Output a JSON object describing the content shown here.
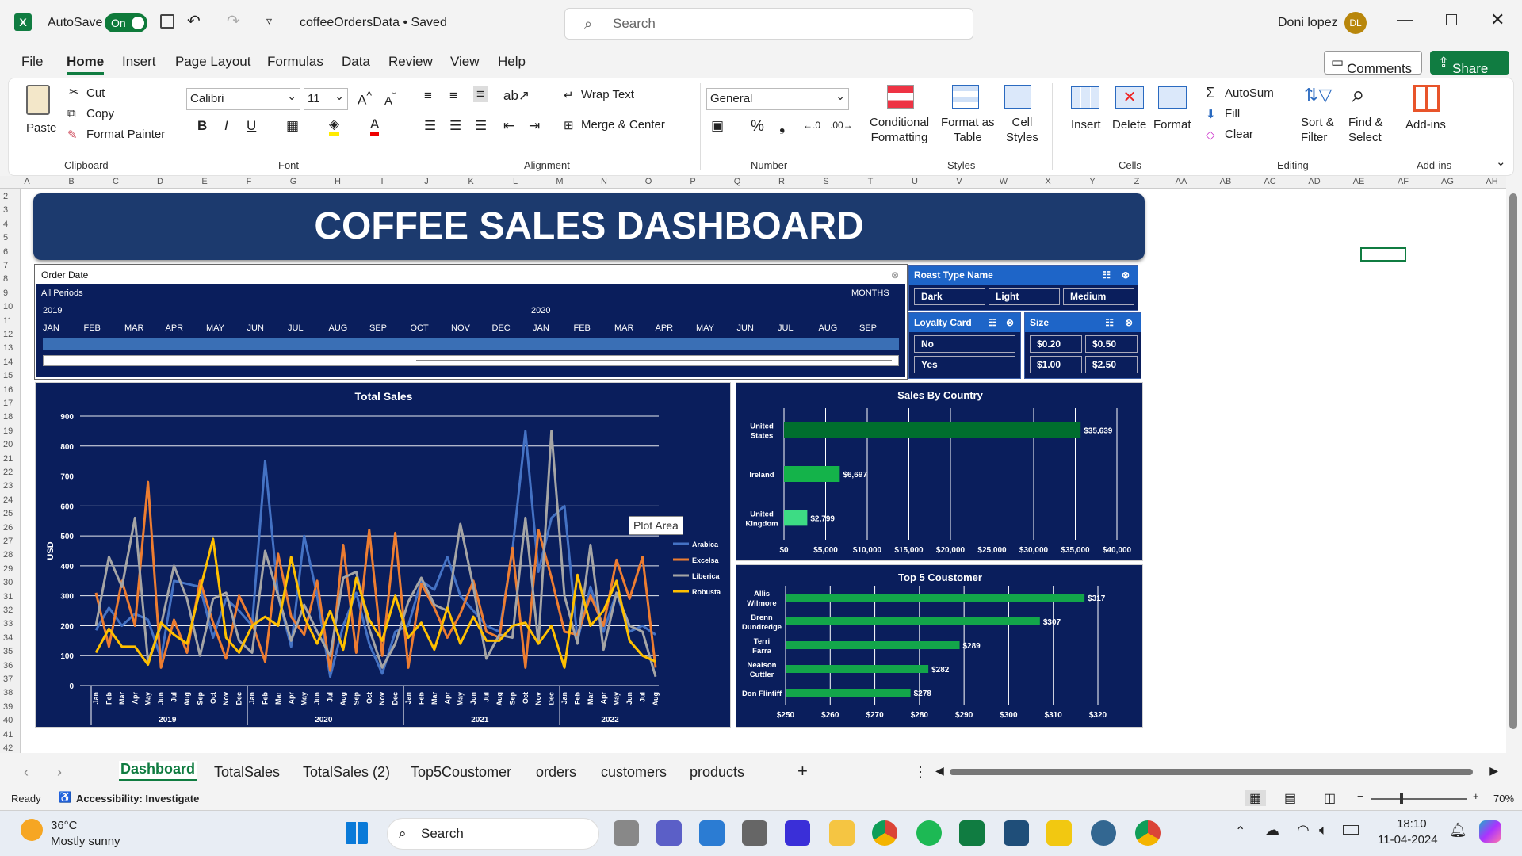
{
  "app": {
    "autosave_label": "AutoSave",
    "autosave_state": "On",
    "filename": "coffeeOrdersData • Saved",
    "search_placeholder": "Search",
    "user_name": "Doni lopez",
    "user_initials": "DL"
  },
  "menu": [
    "File",
    "Home",
    "Insert",
    "Page Layout",
    "Formulas",
    "Data",
    "Review",
    "View",
    "Help"
  ],
  "menu_right": {
    "comments": "Comments",
    "share": "Share"
  },
  "ribbon": {
    "clipboard": {
      "paste": "Paste",
      "cut": "Cut",
      "copy": "Copy",
      "format_painter": "Format Painter",
      "group": "Clipboard"
    },
    "font": {
      "name": "Calibri",
      "size": "11",
      "group": "Font"
    },
    "alignment": {
      "wrap": "Wrap Text",
      "merge": "Merge & Center",
      "group": "Alignment"
    },
    "number": {
      "format": "General",
      "group": "Number"
    },
    "styles": {
      "cond1": "Conditional",
      "cond2": "Formatting",
      "fat1": "Format as",
      "fat2": "Table",
      "cs1": "Cell",
      "cs2": "Styles",
      "group": "Styles"
    },
    "cells": {
      "insert": "Insert",
      "delete": "Delete",
      "format": "Format",
      "group": "Cells"
    },
    "editing": {
      "autosum": "AutoSum",
      "fill": "Fill",
      "clear": "Clear",
      "sort1": "Sort &",
      "sort2": "Filter",
      "find1": "Find &",
      "find2": "Select",
      "group": "Editing"
    },
    "addins": {
      "label": "Add-ins",
      "group": "Add-ins"
    }
  },
  "columns": [
    "A",
    "B",
    "C",
    "D",
    "E",
    "F",
    "G",
    "H",
    "I",
    "J",
    "K",
    "L",
    "M",
    "N",
    "O",
    "P",
    "Q",
    "R",
    "S",
    "T",
    "U",
    "V",
    "W",
    "X",
    "Y",
    "Z",
    "AA",
    "AB",
    "AC",
    "AD",
    "AE",
    "AF",
    "AG",
    "AH"
  ],
  "dashboard": {
    "title": "COFFEE SALES DASHBOARD",
    "timeline": {
      "header": "Order Date",
      "period": "All Periods",
      "unit": "MONTHS",
      "year1": "2019",
      "year2": "2020",
      "months": [
        "JAN",
        "FEB",
        "MAR",
        "APR",
        "MAY",
        "JUN",
        "JUL",
        "AUG",
        "SEP",
        "OCT",
        "NOV",
        "DEC",
        "JAN",
        "FEB",
        "MAR",
        "APR",
        "MAY",
        "JUN",
        "JUL",
        "AUG",
        "SEP"
      ]
    },
    "slicers": {
      "roast": {
        "title": "Roast Type Name",
        "items": [
          "Dark",
          "Light",
          "Medium"
        ]
      },
      "loyalty": {
        "title": "Loyalty Card",
        "items": [
          "No",
          "Yes"
        ]
      },
      "size": {
        "title": "Size",
        "items": [
          "$0.20",
          "$0.50",
          "$1.00",
          "$2.50"
        ]
      }
    },
    "tooltip": "Plot Area"
  },
  "chart_data": [
    {
      "type": "line",
      "title": "Total Sales",
      "ylabel": "USD",
      "ylim": [
        0,
        900
      ],
      "yticks": [
        "900",
        "800",
        "700",
        "600",
        "500",
        "400",
        "300",
        "200",
        "100",
        "0"
      ],
      "x": [
        "Jan",
        "Feb",
        "Mar",
        "Apr",
        "May",
        "Jun",
        "Jul",
        "Aug",
        "Sep",
        "Oct",
        "Nov",
        "Dec",
        "Jan",
        "Feb",
        "Mar",
        "Apr",
        "May",
        "Jun",
        "Jul",
        "Aug",
        "Sep",
        "Oct",
        "Nov",
        "Dec",
        "Jan",
        "Feb",
        "Mar",
        "Apr",
        "May",
        "Jun",
        "Jul",
        "Aug",
        "Sep",
        "Oct",
        "Nov",
        "Dec",
        "Jan",
        "Feb",
        "Mar",
        "Apr",
        "May",
        "Jun",
        "Jul",
        "Aug"
      ],
      "years": [
        "2019",
        "2020",
        "2021",
        "2022"
      ],
      "series": [
        {
          "name": "Arabica",
          "color": "#4472c4",
          "values": [
            185,
            260,
            200,
            240,
            220,
            90,
            350,
            340,
            330,
            160,
            290,
            250,
            200,
            750,
            300,
            130,
            500,
            300,
            30,
            200,
            310,
            140,
            40,
            180,
            200,
            350,
            320,
            430,
            300,
            250,
            200,
            180,
            450,
            850,
            380,
            560,
            600,
            150,
            330,
            180,
            310,
            180,
            200,
            170
          ]
        },
        {
          "name": "Excelsa",
          "color": "#ed7d31",
          "values": [
            310,
            130,
            350,
            200,
            680,
            60,
            220,
            110,
            350,
            210,
            90,
            300,
            210,
            80,
            440,
            230,
            170,
            350,
            50,
            470,
            110,
            520,
            100,
            510,
            60,
            340,
            260,
            160,
            240,
            350,
            180,
            160,
            460,
            60,
            520,
            360,
            180,
            170,
            300,
            200,
            420,
            290,
            430,
            60
          ]
        },
        {
          "name": "Liberica",
          "color": "#a5a5a5",
          "values": [
            200,
            430,
            330,
            560,
            80,
            200,
            400,
            290,
            100,
            290,
            310,
            150,
            110,
            450,
            300,
            150,
            270,
            180,
            100,
            360,
            380,
            190,
            60,
            140,
            280,
            360,
            270,
            250,
            540,
            330,
            90,
            170,
            160,
            560,
            140,
            850,
            300,
            140,
            470,
            120,
            310,
            200,
            180,
            30
          ]
        },
        {
          "name": "Robusta",
          "color": "#ffc000",
          "values": [
            110,
            190,
            130,
            130,
            70,
            210,
            170,
            140,
            320,
            490,
            160,
            110,
            200,
            230,
            200,
            430,
            230,
            140,
            250,
            120,
            360,
            220,
            150,
            300,
            160,
            210,
            120,
            260,
            140,
            230,
            150,
            150,
            200,
            210,
            140,
            200,
            60,
            370,
            200,
            250,
            350,
            150,
            100,
            80
          ]
        }
      ]
    },
    {
      "type": "bar",
      "orientation": "horizontal",
      "title": "Sales By Country",
      "categories": [
        "United States",
        "Ireland",
        "United Kingdom"
      ],
      "values": [
        35639,
        6697,
        2799
      ],
      "labels": [
        "$35,639",
        "$6,697",
        "$2,799"
      ],
      "colors": [
        "#006e2e",
        "#14b34a",
        "#3ddc84"
      ],
      "xlim": [
        0,
        40000
      ],
      "xticks": [
        "$0",
        "$5,000",
        "$10,000",
        "$15,000",
        "$20,000",
        "$25,000",
        "$30,000",
        "$35,000",
        "$40,000"
      ]
    },
    {
      "type": "bar",
      "orientation": "horizontal",
      "title": "Top 5 Coustomer",
      "categories": [
        "Allis Wilmore",
        "Brenn Dundredge",
        "Terri Farra",
        "Nealson Cuttler",
        "Don Flintiff"
      ],
      "values": [
        317,
        307,
        289,
        282,
        278
      ],
      "labels": [
        "$317",
        "$307",
        "$289",
        "$282",
        "$278"
      ],
      "color": "#13a64a",
      "xlim": [
        250,
        320
      ],
      "xticks": [
        "$250",
        "$260",
        "$270",
        "$280",
        "$290",
        "$300",
        "$310",
        "$320"
      ]
    }
  ],
  "sheets": [
    "Dashboard",
    "TotalSales",
    "TotalSales (2)",
    "Top5Coustomer",
    "orders",
    "customers",
    "products"
  ],
  "status": {
    "ready": "Ready",
    "accessibility": "Accessibility: Investigate",
    "zoom": "70%"
  },
  "taskbar": {
    "temp": "36°C",
    "weather": "Mostly sunny",
    "search": "Search",
    "time": "18:10",
    "date": "11-04-2024"
  }
}
